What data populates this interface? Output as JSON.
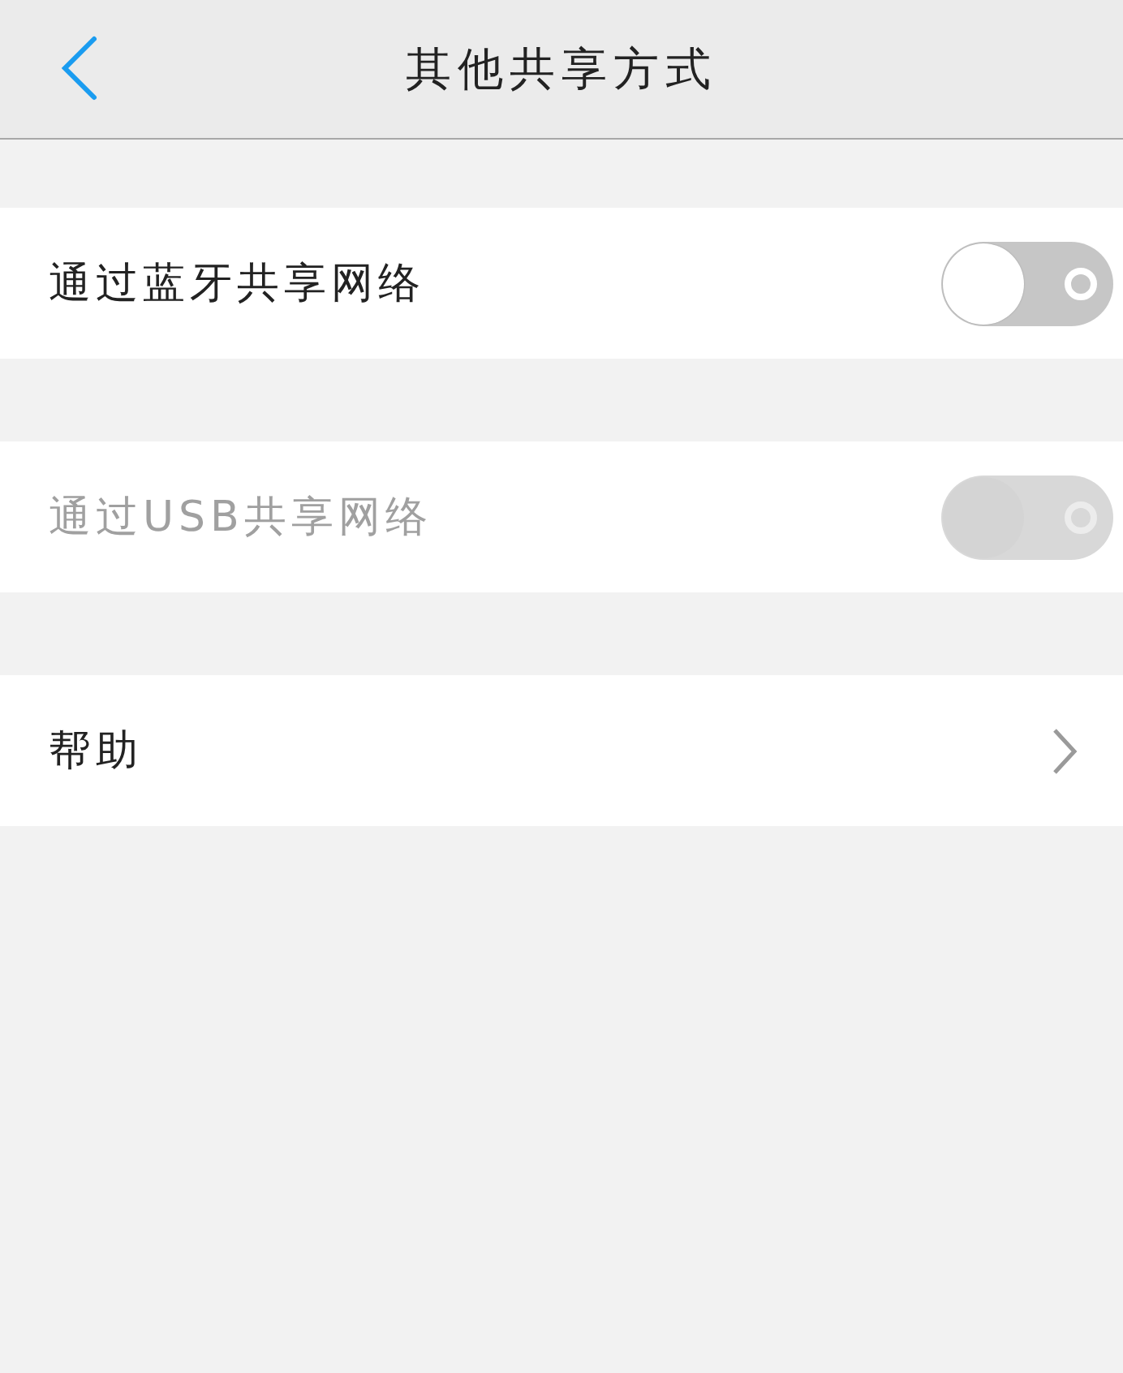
{
  "header": {
    "title": "其他共享方式"
  },
  "rows": [
    {
      "kind": "toggle",
      "label": "通过蓝牙共享网络",
      "on": false,
      "disabled": false
    },
    {
      "kind": "toggle",
      "label": "通过USB共享网络",
      "on": false,
      "disabled": true
    },
    {
      "kind": "link",
      "label": "帮助"
    }
  ]
}
